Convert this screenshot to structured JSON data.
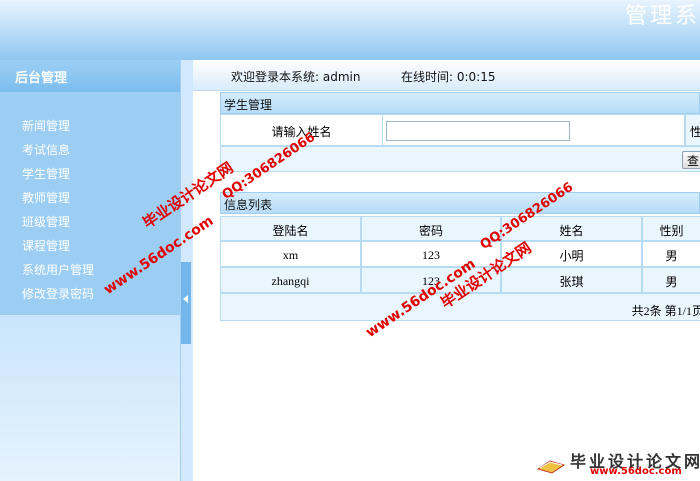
{
  "banner": {
    "title": "管理系"
  },
  "sidebar": {
    "title": "后台管理",
    "items": [
      {
        "label": "新闻管理"
      },
      {
        "label": "考试信息"
      },
      {
        "label": "学生管理"
      },
      {
        "label": "教师管理"
      },
      {
        "label": "班级管理"
      },
      {
        "label": "课程管理"
      },
      {
        "label": "系统用户管理"
      },
      {
        "label": "修改登录密码"
      }
    ]
  },
  "welcome": {
    "greeting": "欢迎登录本系统: admin",
    "online": "在线时间: 0:0:15"
  },
  "search_panel": {
    "title": "学生管理",
    "label": "请输入姓名",
    "input_value": "",
    "gender_label": "性",
    "query_button": "查"
  },
  "list_panel": {
    "title": "信息列表",
    "columns": [
      "登陆名",
      "密码",
      "姓名",
      "性别"
    ],
    "rows": [
      [
        "xm",
        "123",
        "小明",
        "男"
      ],
      [
        "zhangqi",
        "123",
        "张琪",
        "男"
      ]
    ],
    "pagination": "共2条  第1/1页"
  },
  "watermarks": {
    "site": "www.56doc.com",
    "name": "毕业设计论文网",
    "qq": "QQ:306826066",
    "footer_name": "毕业设计论文网",
    "footer_url": "www.56doc.com"
  },
  "colors": {
    "accent": "#7bbdee",
    "watermark": "#e00000"
  }
}
